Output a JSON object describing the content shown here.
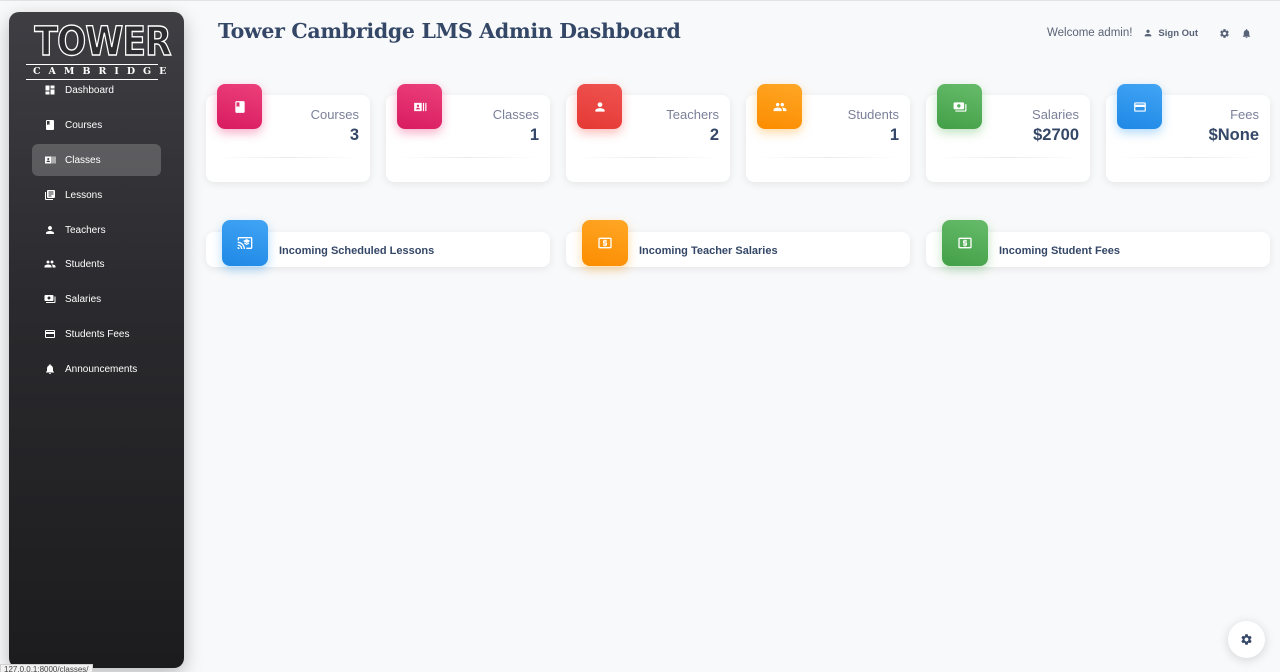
{
  "brand": {
    "name": "TOWER",
    "subtitle": "CAMBRIDGE"
  },
  "sidebar": {
    "items": [
      {
        "label": "Dashboard",
        "icon": "dashboard-icon"
      },
      {
        "label": "Courses",
        "icon": "book-icon"
      },
      {
        "label": "Classes",
        "icon": "class-icon",
        "active": true
      },
      {
        "label": "Lessons",
        "icon": "library-icon"
      },
      {
        "label": "Teachers",
        "icon": "person-icon"
      },
      {
        "label": "Students",
        "icon": "group-icon"
      },
      {
        "label": "Salaries",
        "icon": "money-icon"
      },
      {
        "label": "Students Fees",
        "icon": "credit-card-icon"
      },
      {
        "label": "Announcements",
        "icon": "bell-icon"
      }
    ]
  },
  "header": {
    "title": "Tower Cambridge LMS Admin Dashboard",
    "welcome": "Welcome admin!",
    "sign_out": "Sign Out"
  },
  "stats": [
    {
      "label": "Courses",
      "value": "3",
      "color": "#e91e63",
      "icon": "book-icon"
    },
    {
      "label": "Classes",
      "value": "1",
      "color": "#e91e63",
      "icon": "class-icon"
    },
    {
      "label": "Teachers",
      "value": "2",
      "color": "#f44336",
      "icon": "person-icon"
    },
    {
      "label": "Students",
      "value": "1",
      "color": "#ff9800",
      "icon": "group-icon"
    },
    {
      "label": "Salaries",
      "value": "$2700",
      "color": "#4caf50",
      "icon": "money-icon"
    },
    {
      "label": "Fees",
      "value": "$None",
      "color": "#2196f3",
      "icon": "credit-card-icon"
    }
  ],
  "panels": [
    {
      "title": "Incoming Scheduled Lessons",
      "color": "#2196f3",
      "icon": "cast-for-education-icon"
    },
    {
      "title": "Incoming Teacher Salaries",
      "color": "#ff9800",
      "icon": "local-atm-icon"
    },
    {
      "title": "Incoming Student Fees",
      "color": "#4caf50",
      "icon": "local-atm-icon"
    }
  ],
  "status_url": "127.0.0.1:8000/classes/"
}
